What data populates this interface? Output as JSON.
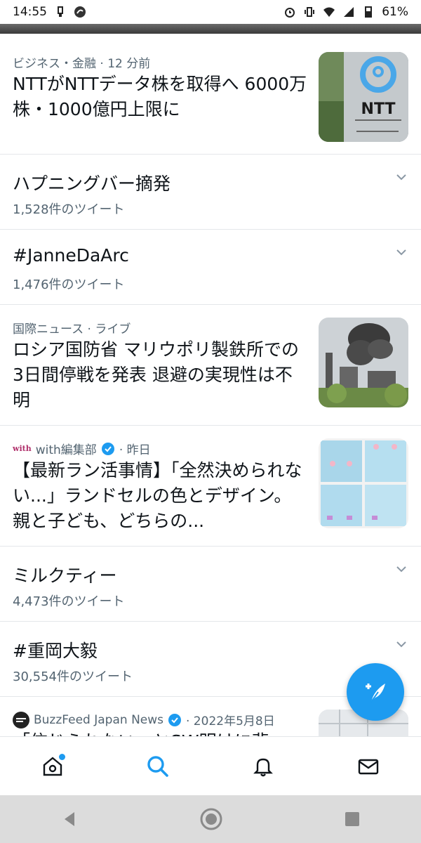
{
  "status_bar": {
    "time": "14:55",
    "battery": "61%"
  },
  "items": [
    {
      "meta": "ビジネス・金融 · 12 分前",
      "headline": "NTTがNTTデータ株を取得へ 6000万株・1000億円上限に"
    },
    {
      "title": "ハプニングバー摘発",
      "count": "1,528件のツイート"
    },
    {
      "title": "#JanneDaArc",
      "count": "1,476件のツイート"
    },
    {
      "meta": "国際ニュース · ライブ",
      "headline": "ロシア国防省 マリウポリ製鉄所での3日間停戦を発表 退避の実現性は不明"
    },
    {
      "logo": "with",
      "source": "with編集部",
      "time": "· 昨日",
      "headline": "【最新ラン活事情】「全然決められない...」ランドセルの色とデザイン。親と子ども、どちらの..."
    },
    {
      "title": "ミルクティー",
      "count": "4,473件のツイート"
    },
    {
      "title": "#重岡大毅",
      "count": "30,554件のツイート"
    },
    {
      "source": "BuzzFeed Japan News",
      "time": "· 2022年5月8日",
      "headline": "「信じられない」とSW明けに悲"
    }
  ],
  "thumb_text": {
    "ntt_logo": "NTT"
  },
  "colors": {
    "accent": "#1d9bf0",
    "secondary_text": "#536471",
    "divider": "#e4e7ea"
  }
}
